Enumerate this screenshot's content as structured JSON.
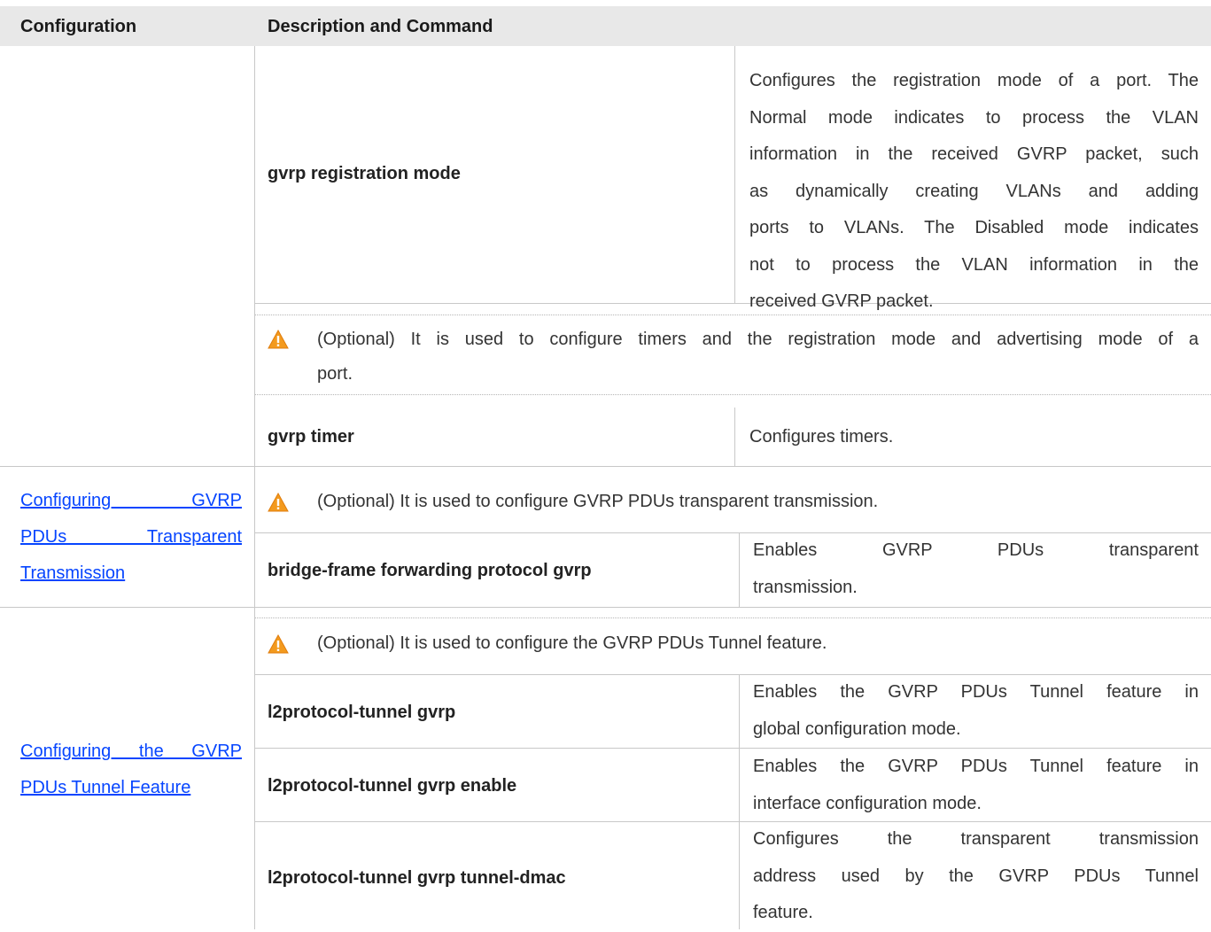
{
  "header": {
    "col1": "Configuration",
    "col2": "Description and Command"
  },
  "registration": {
    "command": "gvrp registration mode",
    "description_lines": [
      "Configures the registration mode of a port. The",
      "Normal mode indicates to process the VLAN",
      "information in the received GVRP packet, such",
      "as dynamically creating VLANs and adding",
      "ports to VLANs. The Disabled mode indicates",
      "not to process the VLAN information in the",
      "received GVRP packet."
    ]
  },
  "timer_note": {
    "line1": "(Optional) It is used to configure timers and the registration mode and advertising mode of a",
    "line2": "port."
  },
  "timer": {
    "command": "gvrp timer",
    "description": "Configures timers."
  },
  "transparent": {
    "link_lines": [
      "Configuring GVRP",
      "PDUs Transparent",
      "Transmission"
    ],
    "note": "(Optional) It is used to configure GVRP PDUs transparent transmission.",
    "command": "bridge-frame forwarding protocol gvrp",
    "description_lines": [
      "Enables GVRP PDUs transparent",
      "transmission."
    ]
  },
  "tunnel": {
    "link_lines": [
      "Configuring the GVRP",
      "PDUs Tunnel Feature"
    ],
    "note": "(Optional) It is used to configure the GVRP PDUs Tunnel feature.",
    "rows": [
      {
        "command": "l2protocol-tunnel gvrp",
        "description_lines": [
          "Enables the GVRP PDUs Tunnel feature in",
          "global configuration mode."
        ]
      },
      {
        "command": "l2protocol-tunnel gvrp enable",
        "description_lines": [
          "Enables the GVRP PDUs Tunnel feature in",
          "interface configuration mode."
        ]
      },
      {
        "command": "l2protocol-tunnel gvrp tunnel-dmac",
        "description_lines": [
          "Configures the transparent transmission",
          "address used by the GVRP PDUs Tunnel",
          "feature."
        ]
      }
    ]
  },
  "icons": {
    "warning": "warning-icon",
    "warning_color": "#f39a1e"
  }
}
